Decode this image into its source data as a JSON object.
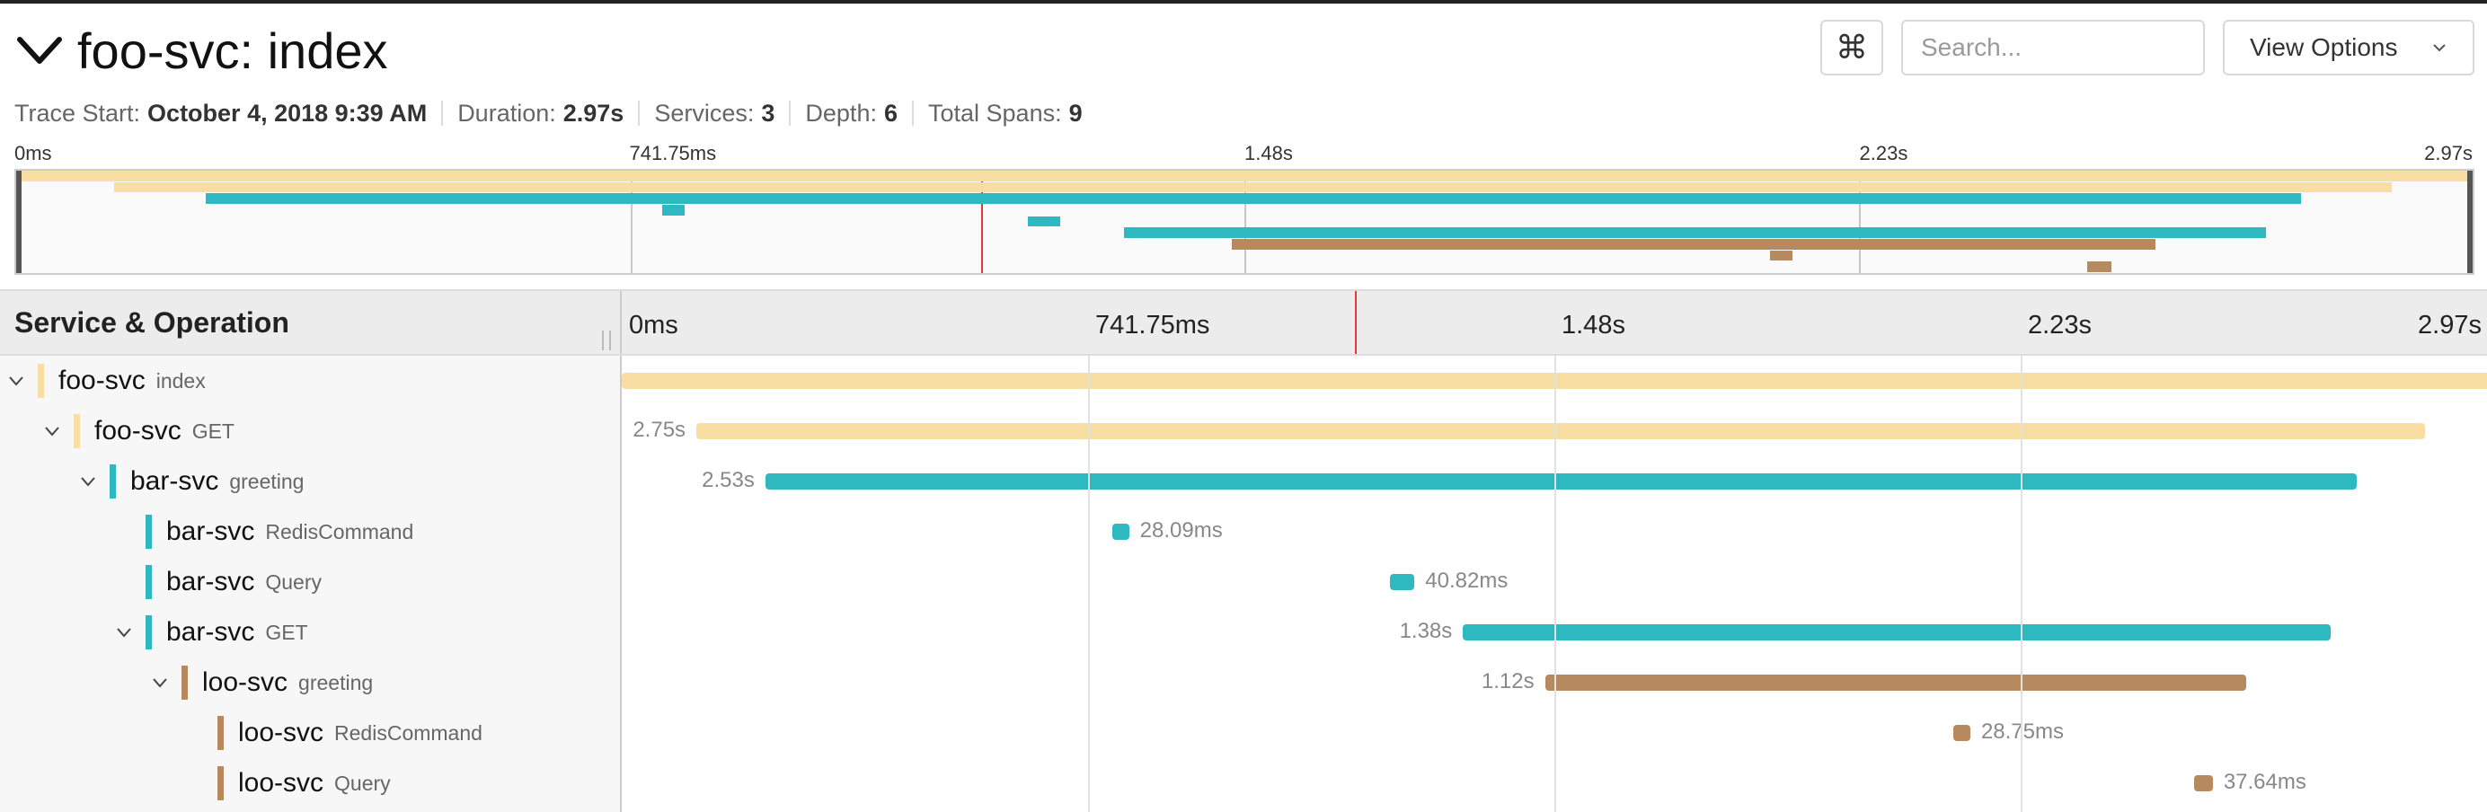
{
  "trace": {
    "title": "foo-svc: index",
    "search_placeholder": "Search...",
    "view_options_label": "View Options",
    "kbd_glyph": "⌘"
  },
  "meta": {
    "trace_start_label": "Trace Start:",
    "trace_start_value": "October 4, 2018 9:39 AM",
    "duration_label": "Duration:",
    "duration_value": "2.97s",
    "services_label": "Services:",
    "services_value": "3",
    "depth_label": "Depth:",
    "depth_value": "6",
    "total_spans_label": "Total Spans:",
    "total_spans_value": "9"
  },
  "ticks": [
    "0ms",
    "741.75ms",
    "1.48s",
    "2.23s",
    "2.97s"
  ],
  "table": {
    "header_label": "Service & Operation"
  },
  "colors": {
    "foo": "#f8dea3",
    "bar": "#2eb9c1",
    "loo": "#b7895f",
    "cursor": "#e53935"
  },
  "cursor_time_fraction": 0.393,
  "rows": [
    {
      "service": "foo-svc",
      "operation": "index",
      "duration": "",
      "start": 0.0,
      "end": 1.0,
      "color": "foo",
      "depth": 0,
      "expanded": true
    },
    {
      "service": "foo-svc",
      "operation": "GET",
      "duration": "2.75s",
      "start": 0.04,
      "end": 0.967,
      "color": "foo",
      "depth": 1,
      "expanded": true
    },
    {
      "service": "bar-svc",
      "operation": "greeting",
      "duration": "2.53s",
      "start": 0.077,
      "end": 0.93,
      "color": "bar",
      "depth": 2,
      "expanded": true
    },
    {
      "service": "bar-svc",
      "operation": "RedisCommand",
      "duration": "28.09ms",
      "start": 0.263,
      "end": 0.272,
      "color": "bar",
      "depth": 3,
      "expanded": null
    },
    {
      "service": "bar-svc",
      "operation": "Query",
      "duration": "40.82ms",
      "start": 0.412,
      "end": 0.425,
      "color": "bar",
      "depth": 3,
      "expanded": null
    },
    {
      "service": "bar-svc",
      "operation": "GET",
      "duration": "1.38s",
      "start": 0.451,
      "end": 0.916,
      "color": "bar",
      "depth": 3,
      "expanded": true
    },
    {
      "service": "loo-svc",
      "operation": "greeting",
      "duration": "1.12s",
      "start": 0.495,
      "end": 0.871,
      "color": "loo",
      "depth": 4,
      "expanded": true
    },
    {
      "service": "loo-svc",
      "operation": "RedisCommand",
      "duration": "28.75ms",
      "start": 0.714,
      "end": 0.723,
      "color": "loo",
      "depth": 5,
      "expanded": null
    },
    {
      "service": "loo-svc",
      "operation": "Query",
      "duration": "37.64ms",
      "start": 0.843,
      "end": 0.853,
      "color": "loo",
      "depth": 5,
      "expanded": null
    }
  ]
}
